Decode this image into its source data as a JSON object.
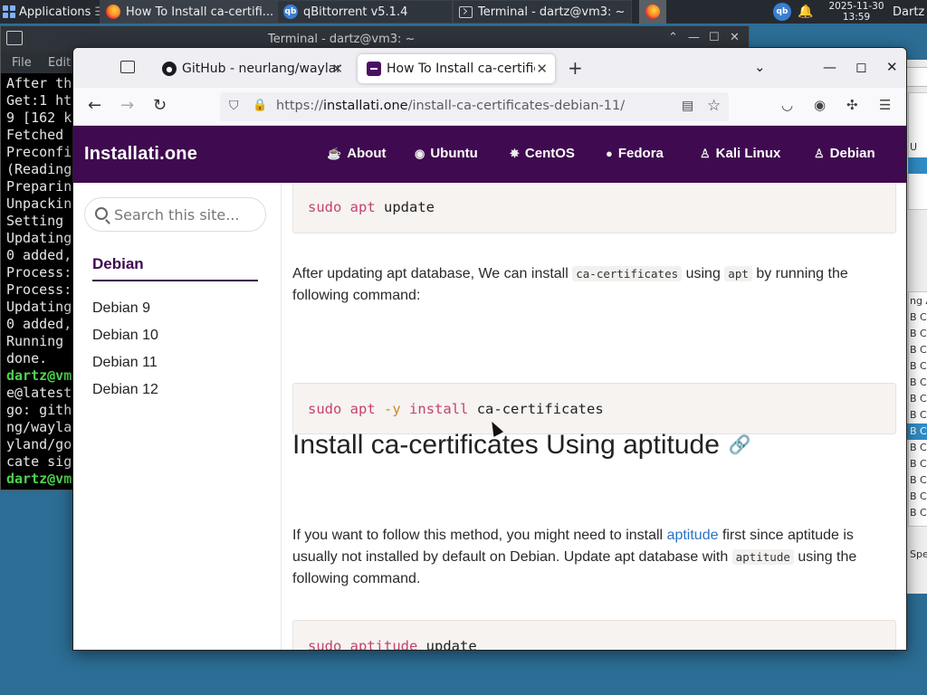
{
  "panel": {
    "applications_label": "Applications",
    "tasks": [
      {
        "label": "How To Install ca-certifi..."
      },
      {
        "label": "qBittorrent v5.1.4"
      },
      {
        "label": "Terminal - dartz@vm3: ~"
      }
    ],
    "date": "2025-11-30",
    "time": "13:59",
    "user": "Dartz"
  },
  "terminal": {
    "title": "Terminal - dartz@vm3: ~",
    "menu": [
      "File",
      "Edit"
    ],
    "lines": [
      {
        "text": "After th",
        "prompt": false
      },
      {
        "text": "Get:1 ht",
        "prompt": false
      },
      {
        "text": "9 [162 k",
        "prompt": false
      },
      {
        "text": "Fetched ",
        "prompt": false
      },
      {
        "text": "Preconfi",
        "prompt": false
      },
      {
        "text": "(Reading",
        "prompt": false
      },
      {
        "text": "Preparin",
        "prompt": false
      },
      {
        "text": "Unpackin",
        "prompt": false
      },
      {
        "text": "Setting ",
        "prompt": false
      },
      {
        "text": "Updating",
        "prompt": false
      },
      {
        "text": "0 added,",
        "prompt": false
      },
      {
        "text": "Process:",
        "prompt": false
      },
      {
        "text": "Process:",
        "prompt": false
      },
      {
        "text": "Updating",
        "prompt": false
      },
      {
        "text": "0 added,",
        "prompt": false
      },
      {
        "text": "Running ",
        "prompt": false
      },
      {
        "text": "done.",
        "prompt": false
      },
      {
        "text": "dartz@vm",
        "prompt": true
      },
      {
        "text": "e@latest",
        "prompt": false
      },
      {
        "text": "go: gith",
        "prompt": false
      },
      {
        "text": "ng/wayla",
        "prompt": false
      },
      {
        "text": "yland/go",
        "prompt": false
      },
      {
        "text": "cate sig",
        "prompt": false
      },
      {
        "text": "dartz@vm",
        "prompt": true
      }
    ]
  },
  "qbittorrent": {
    "fragments": [
      "U",
      "ng A",
      "B C",
      "B C",
      "B C",
      "B C",
      "B C",
      "B C",
      "B C",
      "B C",
      "B C",
      "B C",
      "B C",
      "B C",
      "B C",
      "Spee"
    ]
  },
  "browser": {
    "tabs": [
      {
        "label": "GitHub - neurlang/waylan"
      },
      {
        "label": "How To Install ca-certific"
      }
    ],
    "url_domain": "installati.one",
    "url_prefix": "https://",
    "url_path": "/install-ca-certificates-debian-11/"
  },
  "site": {
    "brand": "Installati.one",
    "nav": [
      "About",
      "Ubuntu",
      "CentOS",
      "Fedora",
      "Kali Linux",
      "Debian"
    ]
  },
  "sidebar": {
    "search_placeholder": "Search this site...",
    "title": "Debian",
    "items": [
      "Debian 9",
      "Debian 10",
      "Debian 11",
      "Debian 12"
    ]
  },
  "article": {
    "code1": {
      "cmd": "sudo",
      "tool": "apt",
      "rest": "update"
    },
    "para1": {
      "before": "After updating apt database, We can install",
      "code_a": "ca-certificates",
      "mid": "using",
      "code_b": "apt",
      "after": "by running the following command:"
    },
    "code2": {
      "cmd": "sudo",
      "tool": "apt",
      "flag": "-y",
      "sub": "install",
      "rest": "ca-certificates"
    },
    "heading": "Install ca-certificates Using aptitude",
    "para2": {
      "before": "If you want to follow this method, you might need to install",
      "link": "aptitude",
      "mid": "first since aptitude is usually not installed by default on Debian. Update apt database with",
      "code": "aptitude",
      "after": "using the following command."
    },
    "code3": {
      "cmd": "sudo",
      "tool": "aptitude",
      "rest": "update"
    }
  }
}
